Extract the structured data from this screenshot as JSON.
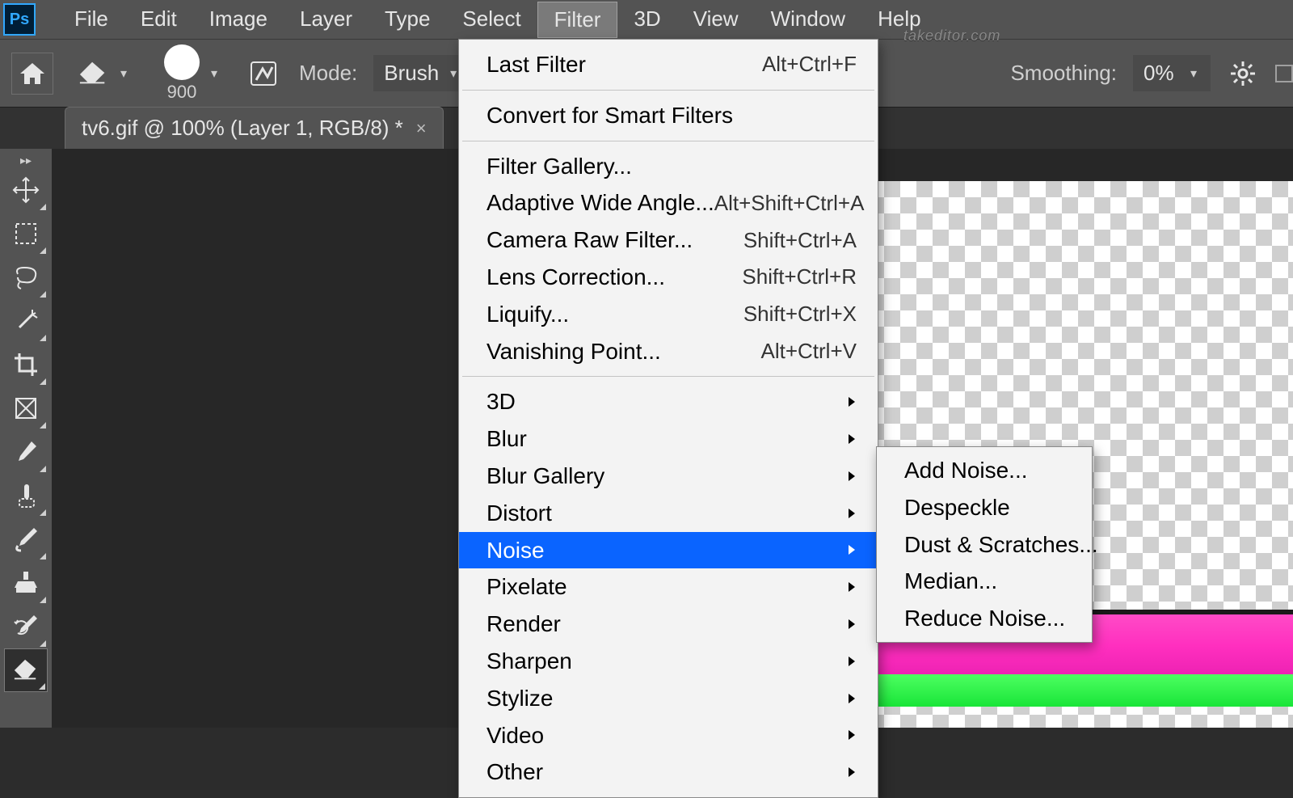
{
  "app": {
    "logo_text": "Ps"
  },
  "menubar": {
    "items": [
      "File",
      "Edit",
      "Image",
      "Layer",
      "Type",
      "Select",
      "Filter",
      "3D",
      "View",
      "Window",
      "Help"
    ],
    "open_index": 6
  },
  "options": {
    "brush_size": "900",
    "mode_label": "Mode:",
    "mode_value": "Brush",
    "smoothing_label": "Smoothing:",
    "smoothing_value": "0%"
  },
  "watermark": "takeditor.com",
  "doc_tab": {
    "title": "tv6.gif @ 100% (Layer 1, RGB/8) *"
  },
  "tools": [
    {
      "name": "move-tool"
    },
    {
      "name": "rectangular-marquee-tool"
    },
    {
      "name": "lasso-tool"
    },
    {
      "name": "magic-wand-tool"
    },
    {
      "name": "crop-tool"
    },
    {
      "name": "frame-tool"
    },
    {
      "name": "eyedropper-tool"
    },
    {
      "name": "spot-healing-brush-tool"
    },
    {
      "name": "brush-tool"
    },
    {
      "name": "clone-stamp-tool"
    },
    {
      "name": "history-brush-tool"
    },
    {
      "name": "eraser-tool"
    }
  ],
  "active_tool_index": 11,
  "filter_menu": {
    "sections": [
      [
        {
          "label": "Last Filter",
          "shortcut": "Alt+Ctrl+F",
          "submenu": false
        }
      ],
      [
        {
          "label": "Convert for Smart Filters",
          "shortcut": "",
          "submenu": false
        }
      ],
      [
        {
          "label": "Filter Gallery...",
          "shortcut": "",
          "submenu": false
        },
        {
          "label": "Adaptive Wide Angle...",
          "shortcut": "Alt+Shift+Ctrl+A",
          "submenu": false
        },
        {
          "label": "Camera Raw Filter...",
          "shortcut": "Shift+Ctrl+A",
          "submenu": false
        },
        {
          "label": "Lens Correction...",
          "shortcut": "Shift+Ctrl+R",
          "submenu": false
        },
        {
          "label": "Liquify...",
          "shortcut": "Shift+Ctrl+X",
          "submenu": false
        },
        {
          "label": "Vanishing Point...",
          "shortcut": "Alt+Ctrl+V",
          "submenu": false
        }
      ],
      [
        {
          "label": "3D",
          "shortcut": "",
          "submenu": true
        },
        {
          "label": "Blur",
          "shortcut": "",
          "submenu": true
        },
        {
          "label": "Blur Gallery",
          "shortcut": "",
          "submenu": true
        },
        {
          "label": "Distort",
          "shortcut": "",
          "submenu": true
        },
        {
          "label": "Noise",
          "shortcut": "",
          "submenu": true,
          "highlight": true
        },
        {
          "label": "Pixelate",
          "shortcut": "",
          "submenu": true
        },
        {
          "label": "Render",
          "shortcut": "",
          "submenu": true
        },
        {
          "label": "Sharpen",
          "shortcut": "",
          "submenu": true
        },
        {
          "label": "Stylize",
          "shortcut": "",
          "submenu": true
        },
        {
          "label": "Video",
          "shortcut": "",
          "submenu": true
        },
        {
          "label": "Other",
          "shortcut": "",
          "submenu": true
        }
      ]
    ]
  },
  "noise_submenu": {
    "items": [
      "Add Noise...",
      "Despeckle",
      "Dust & Scratches...",
      "Median...",
      "Reduce Noise..."
    ]
  }
}
